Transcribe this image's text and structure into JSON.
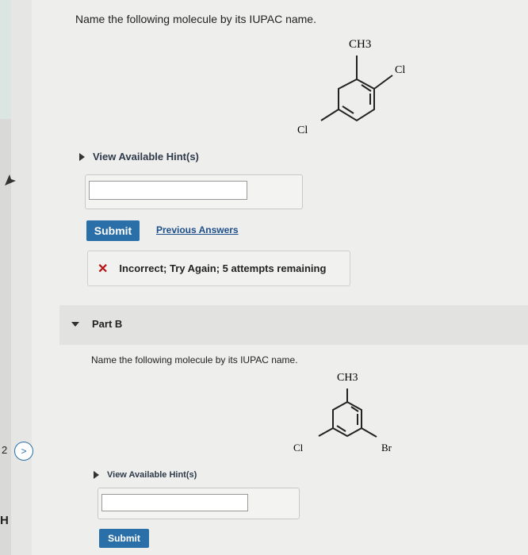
{
  "part_a": {
    "question": "Name the following molecule by its IUPAC name.",
    "molecule": {
      "top_label": "CH3",
      "upper_right_label": "Cl",
      "lower_left_label": "Cl"
    },
    "hint_label": "View Available Hint(s)",
    "submit_label": "Submit",
    "previous_answers_label": "Previous Answers",
    "feedback": "Incorrect; Try Again; 5 attempts remaining"
  },
  "part_b": {
    "header": "Part B",
    "question": "Name the following molecule by its IUPAC name.",
    "molecule": {
      "top_label": "CH3",
      "left_label": "Cl",
      "right_label": "Br"
    },
    "hint_label": "View Available Hint(s)",
    "submit_label": "Submit"
  },
  "left_margin": {
    "page_number": "2",
    "nav_icon": "chevron-right-icon",
    "fragment_text": "H"
  },
  "colors": {
    "submit_bg": "#2a6fa8",
    "error": "#b31313",
    "link": "#1d4f8a"
  }
}
